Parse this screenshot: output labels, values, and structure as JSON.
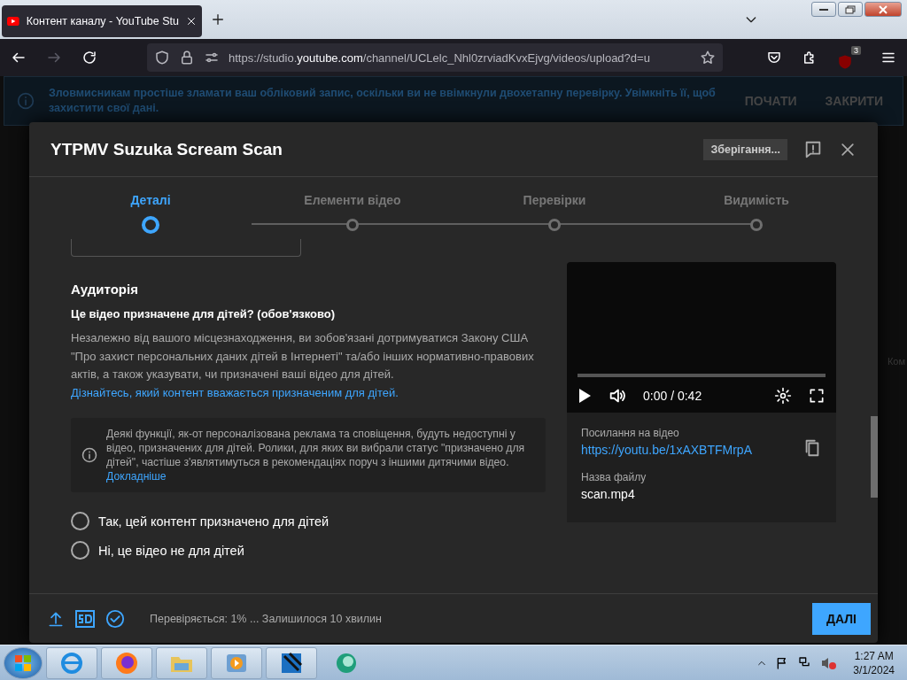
{
  "browser": {
    "tab": {
      "title": "Контент каналу - YouTube Stu",
      "selected": true
    },
    "url": {
      "prefix": "https://studio.",
      "domain": "youtube.com",
      "rest": "/channel/UCLelc_Nhl0zrviadKvxEjvg/videos/upload?d=u"
    },
    "extension_badge": "3",
    "forward_disabled": true
  },
  "banner": {
    "text": "Зловмисникам простіше зламати ваш обліковий запис, оскільки ви не ввімкнули двохетапну перевірку. Увімкніть її, щоб захистити свої дані.",
    "actions": [
      "ПОЧАТИ",
      "ЗАКРИТИ"
    ]
  },
  "background_text": "Ком",
  "dialog": {
    "title": "YTPMV Suzuka Scream Scan",
    "save_status": "Зберігання...",
    "steps": [
      {
        "label": "Деталі",
        "selected": true
      },
      {
        "label": "Елементи відео",
        "selected": false
      },
      {
        "label": "Перевірки",
        "selected": false
      },
      {
        "label": "Видимість",
        "selected": false
      }
    ],
    "audience": {
      "heading": "Аудиторія",
      "question": "Це відео призначене для дітей? (обов'язково)",
      "description": "Незалежно від вашого місцезнаходження, ви зобов'язані дотримуватися Закону США \"Про захист персональних даних дітей в Інтернеті\" та/або інших нормативно-правових актів, а також указувати, чи призначені ваші відео для дітей.",
      "description_link": "Дізнайтесь, який контент вважається призначеним для дітей.",
      "notice": "Деякі функції, як-от персоналізована реклама та сповіщення, будуть недоступні у відео, призначених для дітей. Ролики, для яких ви вибрали статус \"призначено для дітей\", частіше з'являтимуться в рекомендаціях поруч з іншими дитячими відео.",
      "notice_link": "Докладніше",
      "options": [
        {
          "label": "Так, цей контент призначено для дітей",
          "selected": false
        },
        {
          "label": "Ні, це відео не для дітей",
          "selected": false
        }
      ]
    },
    "preview": {
      "time": "0:00 / 0:42",
      "link_label": "Посилання на відео",
      "link": "https://youtu.be/1xAXBTFMrpA",
      "file_label": "Назва файлу",
      "file": "scan.mp4"
    },
    "footer": {
      "status": "Перевіряється: 1% ... Залишилося 10 хвилин",
      "next": "ДАЛІ"
    }
  },
  "taskbar": {
    "time": "1:27 AM",
    "date": "3/1/2024"
  }
}
